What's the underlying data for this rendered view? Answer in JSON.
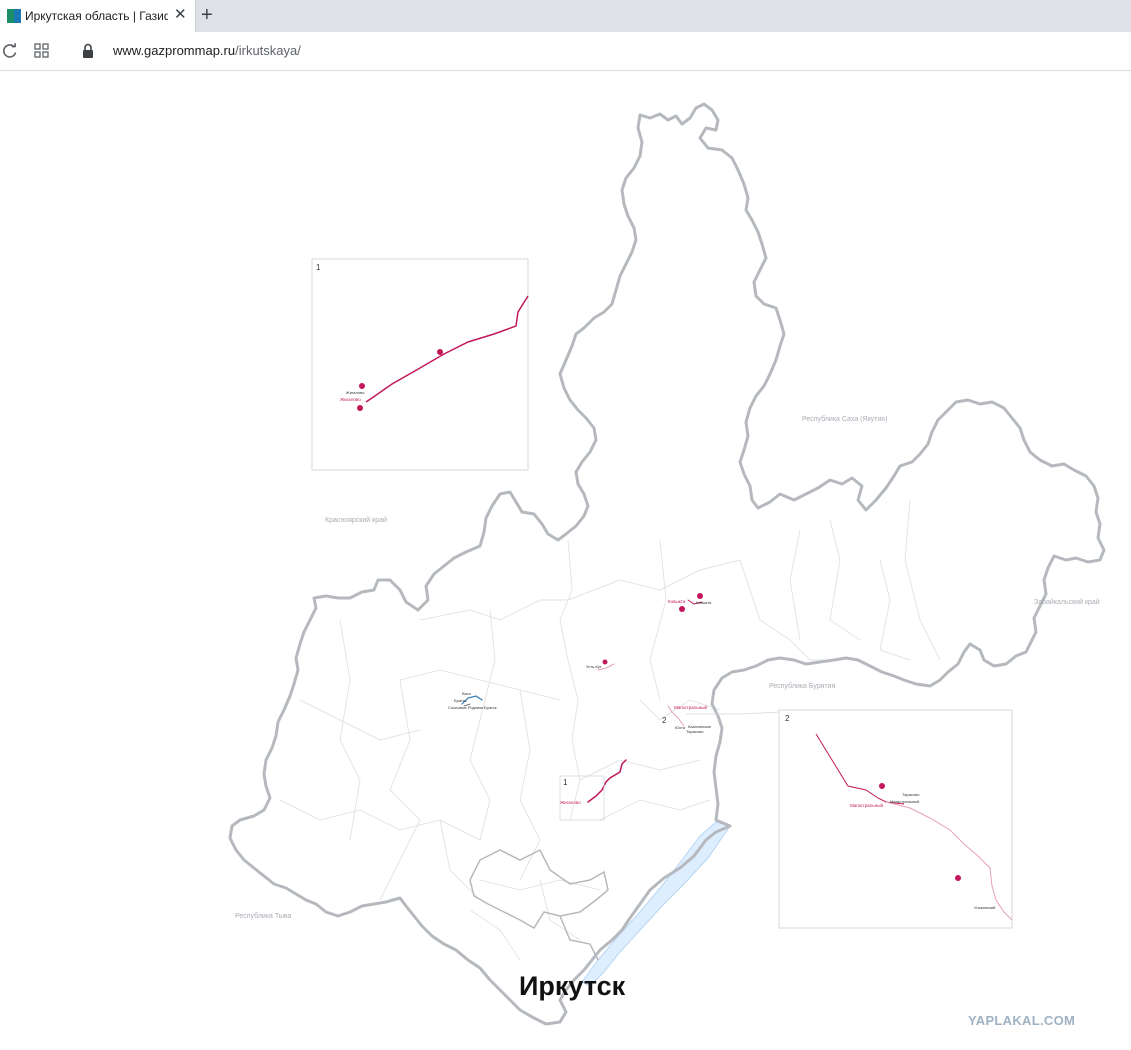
{
  "browser": {
    "tab_title": "Иркутская область | Газиф",
    "tab_close": "✕",
    "new_tab": "+",
    "url_host": "www.gazprommap.ru",
    "url_path": "/irkutskaya/"
  },
  "map": {
    "regions": {
      "yakutia": "Республика Саха (Якутия)",
      "krasnoyarsk": "Красноярский край",
      "zabaikalsky": "Забайкальский край",
      "buryatia": "Республика Бурятия",
      "tyva": "Республика Тыва"
    },
    "city": "Иркутск",
    "watermark": "YAPLAKAL.COM",
    "insets": {
      "one": {
        "number": "1",
        "label_top": "Жигалово",
        "label_main": "Жигалово"
      },
      "two": {
        "number": "2",
        "label_main": "Магистральный",
        "label_a": "Тарасово",
        "label_b": "Магистральный",
        "label_c": "Ульканский"
      }
    },
    "markers": {
      "kovykta_label": "Ковыкта",
      "kovykta_b": "Ковыкта",
      "ust_kut": "Усть-Кут",
      "bratsk_a": "Вихо",
      "bratsk_b": "Братск",
      "bratsk_c": "Сосновые Родники",
      "bratsk_d": "Братск",
      "magistralny": "Магистральный",
      "zhigalovo": "Жигалово",
      "num2": "2",
      "num1": "1",
      "uk_a": "Юхта",
      "uk_b": "Казачинское",
      "uk_c": "Тарасово"
    },
    "colors": {
      "border": "#b5b9be",
      "district": "#e2e4e6",
      "pipeline": "#c2185b",
      "pipeline_light": "#e7a1b8",
      "baikal": "#ddeeff",
      "baikal_edge": "#b8d6f2",
      "bratsk_line": "#2a7ab8"
    },
    "icons": {
      "reload": "reload-icon",
      "apps": "apps-icon",
      "lock": "lock-icon",
      "marker": "pipeline-marker-icon"
    }
  }
}
